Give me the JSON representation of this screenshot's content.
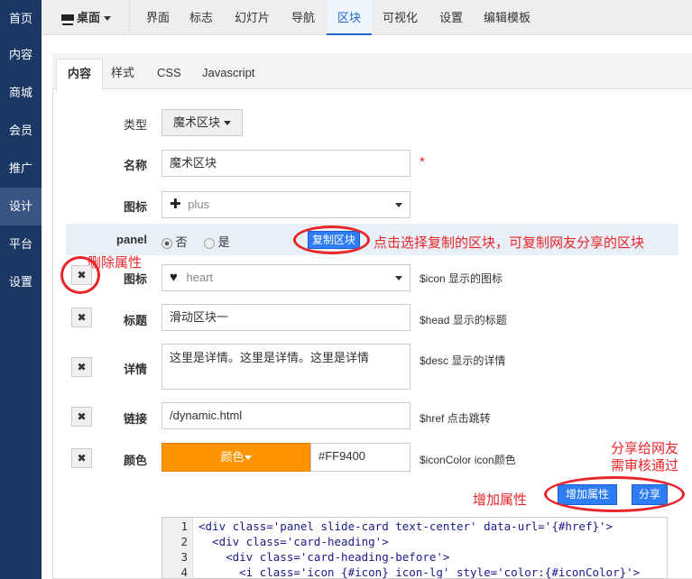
{
  "sidebar": {
    "items": [
      {
        "label": "首页"
      },
      {
        "label": "内容"
      },
      {
        "label": "商城"
      },
      {
        "label": "会员"
      },
      {
        "label": "推广"
      },
      {
        "label": "设计",
        "active": true
      },
      {
        "label": "平台"
      },
      {
        "label": "设置"
      }
    ]
  },
  "topnav": {
    "device": "桌面",
    "items": [
      "界面",
      "标志",
      "幻灯片",
      "导航",
      "区块",
      "可视化",
      "设置",
      "编辑模板"
    ],
    "active": "区块"
  },
  "tabs": [
    "内容",
    "样式",
    "CSS",
    "Javascript"
  ],
  "form": {
    "type": {
      "label": "类型",
      "value": "魔术区块"
    },
    "name": {
      "label": "名称",
      "value": "魔术区块",
      "required": "*"
    },
    "icon": {
      "label": "图标",
      "value": "plus"
    },
    "panel": {
      "label": "panel",
      "options": [
        "否",
        "是"
      ],
      "selected": "否",
      "copy_button": "复制区块"
    },
    "attrs": [
      {
        "label": "图标",
        "value": "heart",
        "desc": "$icon 显示的图标"
      },
      {
        "label": "标题",
        "value": "滑动区块一",
        "desc": "$head 显示的标题"
      },
      {
        "label": "详情",
        "value": "这里是详情。这里是详情。这里是详情",
        "desc": "$desc 显示的详情"
      },
      {
        "label": "链接",
        "value": "/dynamic.html",
        "desc": "$href 点击跳转"
      },
      {
        "label": "颜色",
        "button": "颜色",
        "value": "#FF9400",
        "desc": "$iconColor icon颜色"
      }
    ],
    "add_button": "增加属性",
    "share_button": "分享"
  },
  "annotations": {
    "copy": "点击选择复制的区块，可复制网友分享的区块",
    "delete": "删除属性",
    "add": "增加属性",
    "share_1": "分享给网友",
    "share_2": "需审核通过"
  },
  "code": {
    "lines": [
      {
        "n": "1",
        "text": "<div class='panel slide-card text-center' data-url='{#href}'>"
      },
      {
        "n": "2",
        "text": "  <div class='card-heading'>"
      },
      {
        "n": "3",
        "text": "    <div class='card-heading-before'>"
      },
      {
        "n": "4",
        "text": "      <i class='icon {#icon} icon-lg' style='color:{#iconColor}'>"
      }
    ]
  },
  "colors": {
    "sidebar": "#1b3766",
    "accent": "#2f7df6",
    "swatch": "#FF9400",
    "annotation": "#e8262a"
  }
}
